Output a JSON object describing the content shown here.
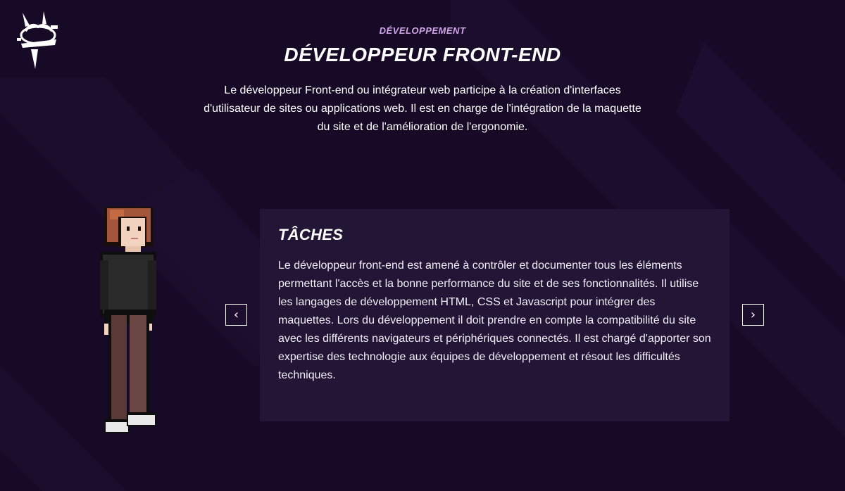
{
  "header": {
    "category": "DÉVELOPPEMENT",
    "title": "DÉVELOPPEUR FRONT-END",
    "intro": "Le développeur Front-end ou intégrateur web participe à la création d'interfaces d'utilisateur de sites ou applications web. Il est en charge de l'intégration de la maquette du site et de l'amélioration de l'ergonomie."
  },
  "card": {
    "title": "TÂCHES",
    "text": "Le développeur front-end est amené à contrôler et documenter tous les éléments permettant l'accès et la bonne performance du site et de ses fonctionnalités. Il utilise les langages de développement HTML, CSS et Javascript pour intégrer des maquettes. Lors du développement il doit prendre en compte la compatibilité du site avec les différents navigateurs et périphériques connectés. Il est chargé d'apporter son expertise des technologie aux équipes de développement et résout les difficultés techniques."
  },
  "nav": {
    "prev_icon": "chevron-left-icon",
    "prev_glyph": "‹",
    "next_icon": "chevron-right-icon",
    "next_glyph": "›"
  },
  "colors": {
    "background": "#170a26",
    "card": "#221536",
    "accent": "#cfa6e8"
  }
}
